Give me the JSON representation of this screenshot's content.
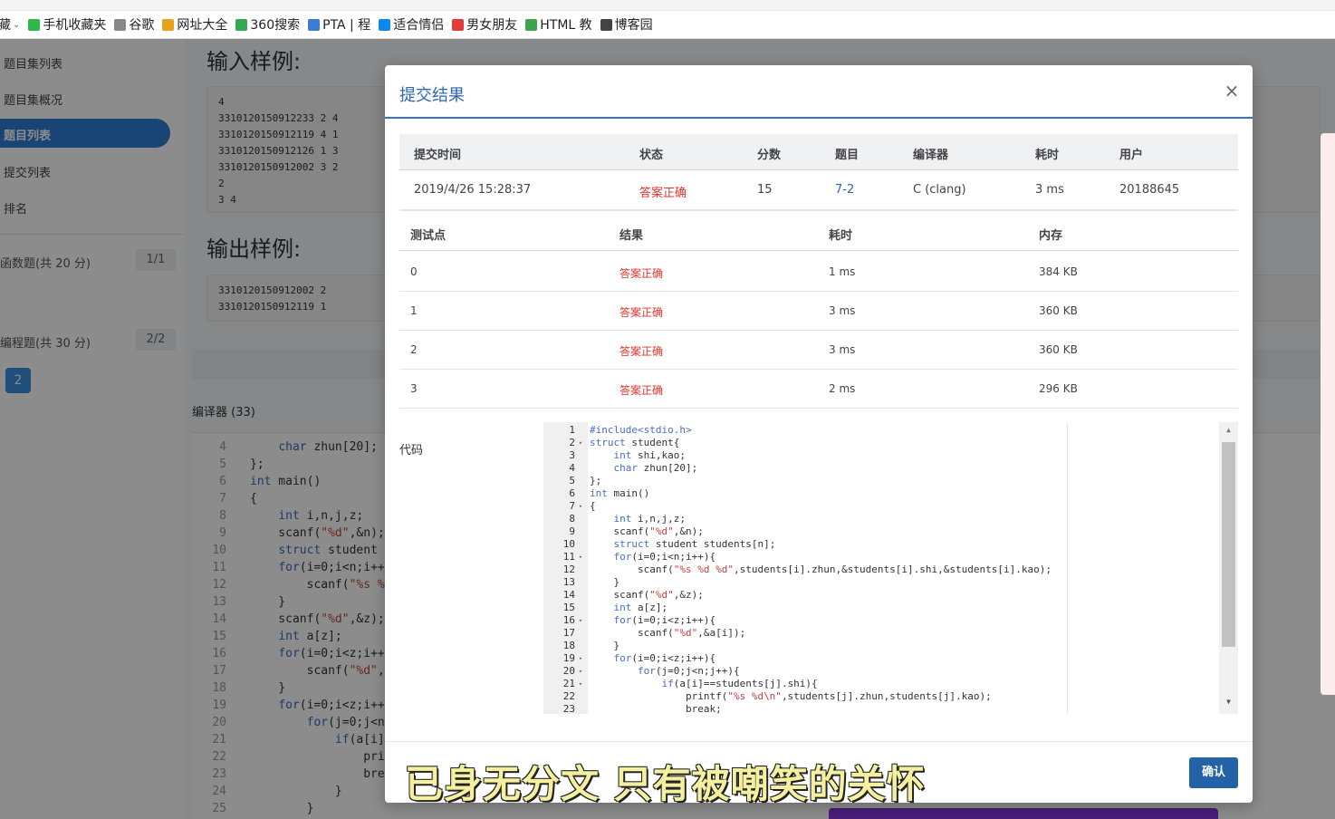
{
  "bookmarks": [
    {
      "label": "藏",
      "icon": "bookmark-folder-icon",
      "color": "#777777"
    },
    {
      "label": "手机收藏夹",
      "icon": "phone-icon",
      "color": "#2db84b"
    },
    {
      "label": "谷歌",
      "icon": "page-icon",
      "color": "#888888"
    },
    {
      "label": "网址大全",
      "icon": "globe-icon",
      "color": "#e8a21c"
    },
    {
      "label": "360搜索",
      "icon": "search-360-icon",
      "color": "#35a853"
    },
    {
      "label": "PTA | 程",
      "icon": "pta-icon",
      "color": "#3a7bd5"
    },
    {
      "label": "适合情侣",
      "icon": "zhihu-icon",
      "color": "#0f88eb"
    },
    {
      "label": "男女朋友",
      "icon": "news-icon",
      "color": "#e23b3b"
    },
    {
      "label": "HTML 教",
      "icon": "html-icon",
      "color": "#3fa34d"
    },
    {
      "label": "博客园",
      "icon": "blog-icon",
      "color": "#444444"
    }
  ],
  "sidebar": {
    "items": [
      {
        "label": "题目集列表"
      },
      {
        "label": "题目集概况"
      },
      {
        "label": "题目列表",
        "active": true
      },
      {
        "label": "提交列表"
      },
      {
        "label": "排名"
      }
    ],
    "sections": [
      {
        "label": "函数题(共 20 分)",
        "count": "1/1"
      },
      {
        "label": "编程题(共 30 分)",
        "count": "2/2"
      }
    ],
    "page_chip": "2"
  },
  "background": {
    "input_heading": "输入样例:",
    "input_sample": "4\n3310120150912233 2 4\n3310120150912119 4 1\n3310120150912126 1 3\n3310120150912002 3 2\n2\n3 4",
    "output_heading": "输出样例:",
    "output_sample": "3310120150912002 2\n3310120150912119 1",
    "compiler_label": "编译器 (33)",
    "code_lines": [
      {
        "n": "4",
        "t": "    char zhun[20];"
      },
      {
        "n": "5",
        "t": "};"
      },
      {
        "n": "6",
        "t": "int main()"
      },
      {
        "n": "7",
        "t": "{"
      },
      {
        "n": "8",
        "t": "    int i,n,j,z;"
      },
      {
        "n": "9",
        "t": "    scanf(\"%d\",&n);"
      },
      {
        "n": "10",
        "t": "    struct student s"
      },
      {
        "n": "11",
        "t": "    for(i=0;i<n;i++"
      },
      {
        "n": "12",
        "t": "        scanf(\"%s %"
      },
      {
        "n": "13",
        "t": "    }"
      },
      {
        "n": "14",
        "t": "    scanf(\"%d\",&z);"
      },
      {
        "n": "15",
        "t": "    int a[z];"
      },
      {
        "n": "16",
        "t": "    for(i=0;i<z;i++"
      },
      {
        "n": "17",
        "t": "        scanf(\"%d\",&"
      },
      {
        "n": "18",
        "t": "    }"
      },
      {
        "n": "19",
        "t": "    for(i=0;i<z;i++"
      },
      {
        "n": "20",
        "t": "        for(j=0;j<n"
      },
      {
        "n": "21",
        "t": "            if(a[i]="
      },
      {
        "n": "22",
        "t": "                pri"
      },
      {
        "n": "23",
        "t": "                bre"
      },
      {
        "n": "24",
        "t": "            }"
      },
      {
        "n": "25",
        "t": "        }"
      }
    ]
  },
  "modal": {
    "title": "提交结果",
    "close_label": "×",
    "summary_headers": [
      "提交时间",
      "状态",
      "分数",
      "题目",
      "编译器",
      "耗时",
      "用户"
    ],
    "summary_row": {
      "time": "2019/4/26 15:28:37",
      "status": "答案正确",
      "score": "15",
      "problem": "7-2",
      "compiler": "C (clang)",
      "duration": "3 ms",
      "user": "20188645"
    },
    "test_headers": [
      "测试点",
      "结果",
      "耗时",
      "内存"
    ],
    "test_rows": [
      {
        "point": "0",
        "result": "答案正确",
        "time": "1 ms",
        "memory": "384 KB"
      },
      {
        "point": "1",
        "result": "答案正确",
        "time": "3 ms",
        "memory": "360 KB"
      },
      {
        "point": "2",
        "result": "答案正确",
        "time": "3 ms",
        "memory": "360 KB"
      },
      {
        "point": "3",
        "result": "答案正确",
        "time": "2 ms",
        "memory": "296 KB"
      }
    ],
    "code_label": "代码",
    "code": [
      {
        "n": "1",
        "fold": "",
        "t": "#include<stdio.h>"
      },
      {
        "n": "2",
        "fold": "▾",
        "t": "struct student{"
      },
      {
        "n": "3",
        "fold": "",
        "t": "    int shi,kao;"
      },
      {
        "n": "4",
        "fold": "",
        "t": "    char zhun[20];"
      },
      {
        "n": "5",
        "fold": "",
        "t": "};"
      },
      {
        "n": "6",
        "fold": "",
        "t": "int main()"
      },
      {
        "n": "7",
        "fold": "▾",
        "t": "{"
      },
      {
        "n": "8",
        "fold": "",
        "t": "    int i,n,j,z;"
      },
      {
        "n": "9",
        "fold": "",
        "t": "    scanf(\"%d\",&n);"
      },
      {
        "n": "10",
        "fold": "",
        "t": "    struct student students[n];"
      },
      {
        "n": "11",
        "fold": "▾",
        "t": "    for(i=0;i<n;i++){"
      },
      {
        "n": "12",
        "fold": "",
        "t": "        scanf(\"%s %d %d\",students[i].zhun,&students[i].shi,&students[i].kao);"
      },
      {
        "n": "13",
        "fold": "",
        "t": "    }"
      },
      {
        "n": "14",
        "fold": "",
        "t": "    scanf(\"%d\",&z);"
      },
      {
        "n": "15",
        "fold": "",
        "t": "    int a[z];"
      },
      {
        "n": "16",
        "fold": "▾",
        "t": "    for(i=0;i<z;i++){"
      },
      {
        "n": "17",
        "fold": "",
        "t": "        scanf(\"%d\",&a[i]);"
      },
      {
        "n": "18",
        "fold": "",
        "t": "    }"
      },
      {
        "n": "19",
        "fold": "▾",
        "t": "    for(i=0;i<z;i++){"
      },
      {
        "n": "20",
        "fold": "▾",
        "t": "        for(j=0;j<n;j++){"
      },
      {
        "n": "21",
        "fold": "▾",
        "t": "            if(a[i]==students[j].shi){"
      },
      {
        "n": "22",
        "fold": "",
        "t": "                printf(\"%s %d\\n\",students[j].zhun,students[j].kao);"
      },
      {
        "n": "23",
        "fold": "",
        "t": "                break;"
      }
    ],
    "confirm_label": "确认"
  },
  "caption": "已身无分文 只有被嘲笑的关怀",
  "colors": {
    "accent": "#2f66b3",
    "success_text": "#e0332c",
    "confirm_button": "#2462a8",
    "caption": "#f5f0a0"
  }
}
